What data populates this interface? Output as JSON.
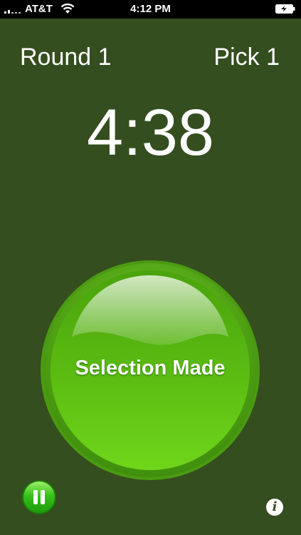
{
  "status_bar": {
    "carrier": "AT&T",
    "time": "4:12 PM",
    "icons": [
      "signal-icon",
      "wifi-icon",
      "battery-icon"
    ]
  },
  "draft": {
    "round_label": "Round 1",
    "pick_label": "Pick 1",
    "timer": "4:38"
  },
  "actions": {
    "selection_made_label": "Selection Made",
    "pause_icon": "pause-icon",
    "info_glyph": "i"
  },
  "colors": {
    "background": "#344e1f",
    "button_green": "#55b80f",
    "status_bar": "#000000"
  }
}
